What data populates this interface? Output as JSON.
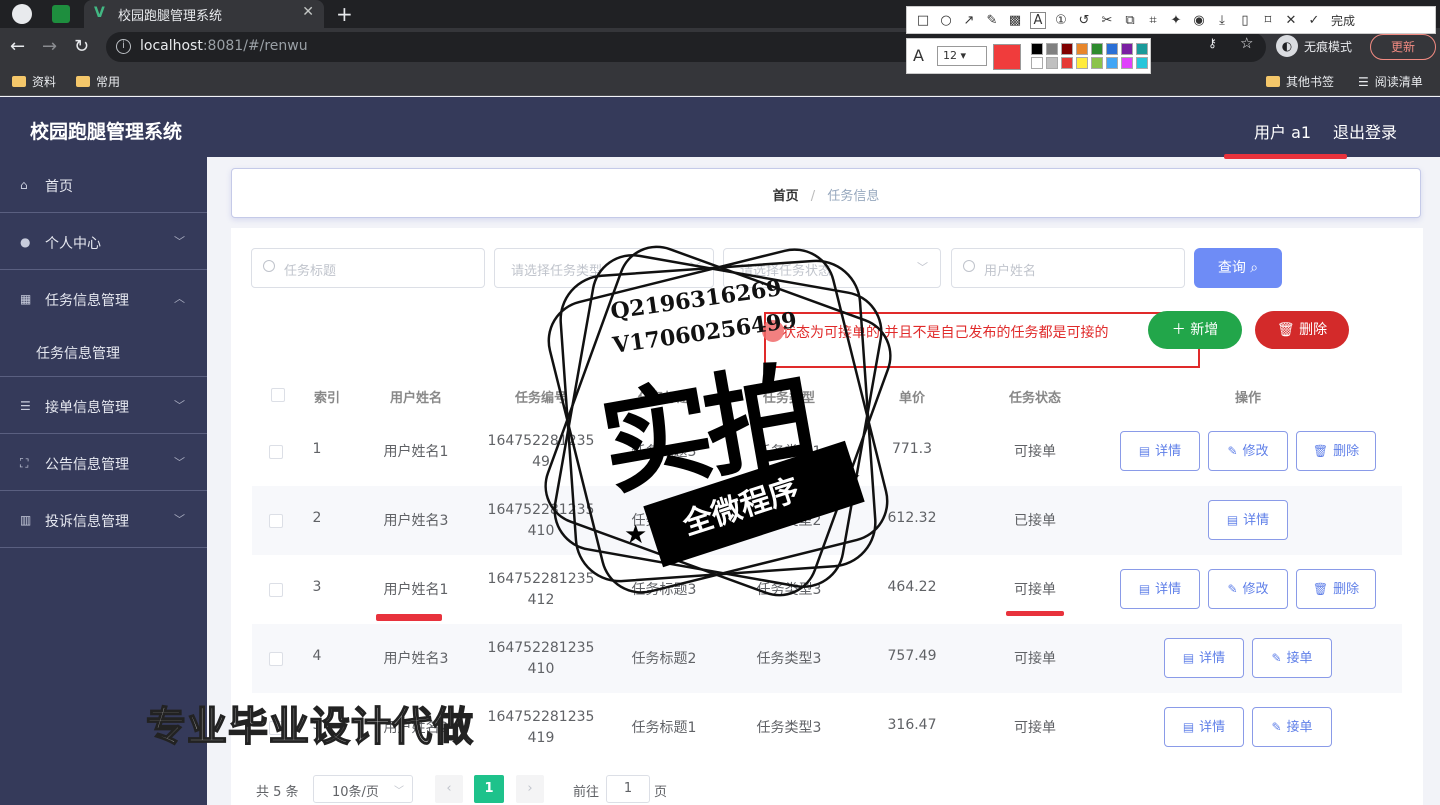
{
  "browser": {
    "tab_title": "校园跑腿管理系统",
    "url_host": "localhost",
    "url_rest": ":8081/#/renwu",
    "incognito_label": "无痕模式",
    "update_label": "更新",
    "bookmarks": [
      "资料",
      "常用"
    ],
    "bookmarks_right": [
      "其他书签",
      "阅读清单"
    ]
  },
  "snap_toolbar": {
    "done_label": "完成",
    "font_size": "12",
    "colors": [
      "#000000",
      "#808080",
      "#800000",
      "#e8862a",
      "#2e8b2e",
      "#2a6fd6",
      "#7a1fa2",
      "#1a9a9a",
      "#ffffff",
      "#c0c0c0",
      "#e53935",
      "#ffeb3b",
      "#8bc34a",
      "#42a5f5",
      "#e040fb",
      "#26c6da"
    ]
  },
  "app": {
    "title": "校园跑腿管理系统",
    "user_label": "用户 a1",
    "logout_label": "退出登录"
  },
  "sidebar": {
    "items": [
      {
        "label": "首页",
        "icon": "home-icon"
      },
      {
        "label": "个人中心",
        "icon": "user-icon"
      },
      {
        "label": "任务信息管理",
        "icon": "grid-icon"
      },
      {
        "label": "任务信息管理",
        "icon": ""
      },
      {
        "label": "接单信息管理",
        "icon": "list-icon"
      },
      {
        "label": "公告信息管理",
        "icon": "frame-icon"
      },
      {
        "label": "投诉信息管理",
        "icon": "chart-icon"
      }
    ]
  },
  "breadcrumb": {
    "home": "首页",
    "separator": "/",
    "current": "任务信息"
  },
  "search": {
    "title_placeholder": "任务标题",
    "type_placeholder": "请选择任务类型",
    "status_placeholder": "请选择任务状态",
    "username_placeholder": "用户姓名",
    "query_label": "查询"
  },
  "actions": {
    "add_label": "新增",
    "delete_label": "删除"
  },
  "note": "状态为可接单的 并且不是自己发布的任务都是可接的",
  "table": {
    "headers": [
      "索引",
      "用户姓名",
      "任务编号",
      "任务标题",
      "任务类型",
      "单价",
      "任务状态",
      "操作"
    ],
    "rows": [
      {
        "index": "1",
        "user": "用户姓名1",
        "code1": "164752281235",
        "code2": "49",
        "title": "任务标题3",
        "type": "任务类型1",
        "price": "771.3",
        "status": "可接单",
        "buttons": [
          "详情",
          "修改",
          "删除"
        ]
      },
      {
        "index": "2",
        "user": "用户姓名3",
        "code1": "164752281235",
        "code2": "410",
        "title": "任务标题1",
        "type": "任务类型2",
        "price": "612.32",
        "status": "已接单",
        "buttons": [
          "详情"
        ]
      },
      {
        "index": "3",
        "user": "用户姓名1",
        "code1": "164752281235",
        "code2": "412",
        "title": "任务标题3",
        "type": "任务类型3",
        "price": "464.22",
        "status": "可接单",
        "buttons": [
          "详情",
          "修改",
          "删除"
        ]
      },
      {
        "index": "4",
        "user": "用户姓名3",
        "code1": "164752281235",
        "code2": "410",
        "title": "任务标题2",
        "type": "任务类型3",
        "price": "757.49",
        "status": "可接单",
        "buttons": [
          "详情",
          "接单"
        ]
      },
      {
        "index": "5",
        "user": "用户姓名2",
        "code1": "164752281235",
        "code2": "419",
        "title": "任务标题1",
        "type": "任务类型3",
        "price": "316.47",
        "status": "可接单",
        "buttons": [
          "详情",
          "接单"
        ]
      }
    ]
  },
  "pagination": {
    "total": "共 5 条",
    "page_size": "10条/页",
    "current_page": "1",
    "goto_label": "前往",
    "goto_value": "1",
    "page_unit": "页"
  },
  "watermark": {
    "line1": "Q2196316269",
    "line2": "V17060256499",
    "big": "实拍",
    "ribbon": "全微程序",
    "bottom": "专业毕业设计代做"
  }
}
